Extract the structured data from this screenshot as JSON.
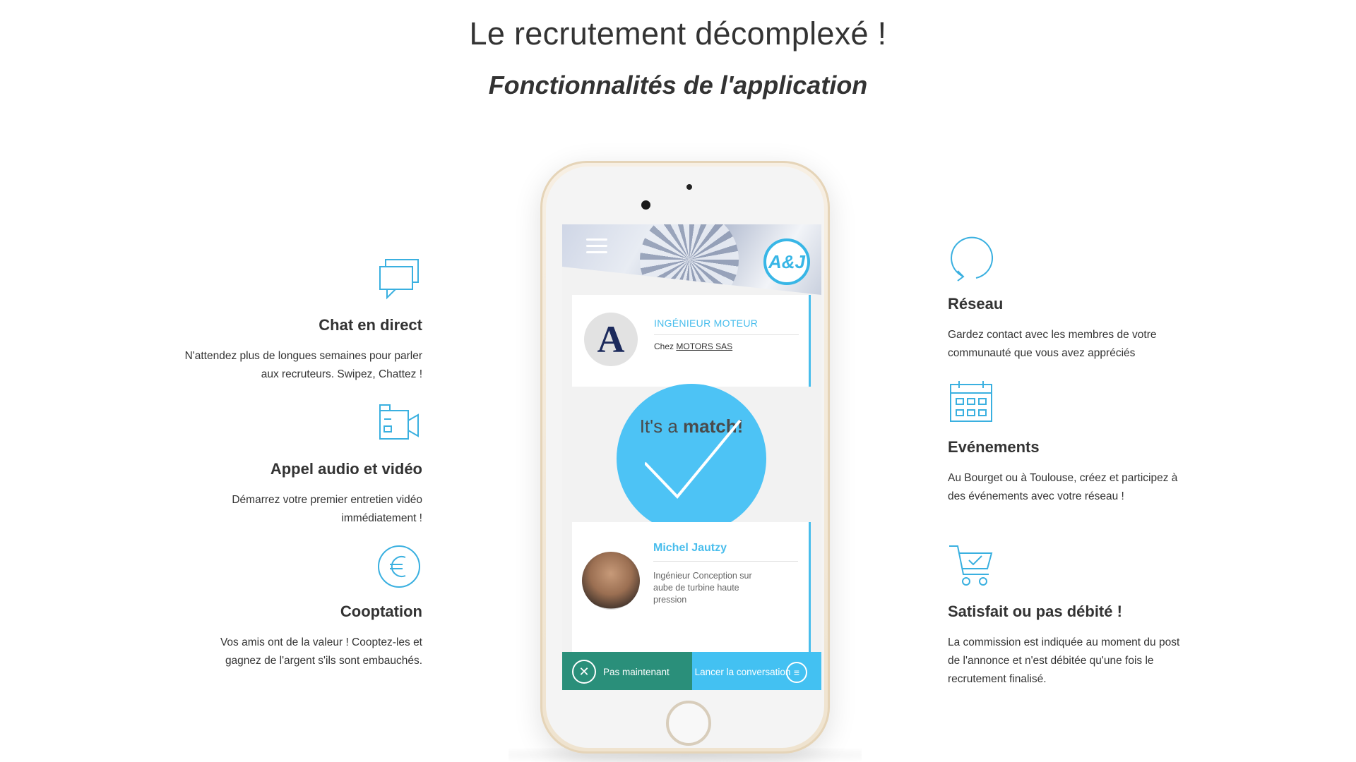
{
  "header": {
    "title": "Le recrutement décomplexé !",
    "subtitle": "Fonctionnalités de l'application"
  },
  "features_left": [
    {
      "icon": "chat-icon",
      "title": "Chat en direct",
      "text": "N'attendez plus de longues semaines pour parler aux recruteurs. Swipez, Chattez !"
    },
    {
      "icon": "video-call-icon",
      "title": "Appel audio et vidéo",
      "text": "Démarrez votre premier entretien vidéo immédiatement !"
    },
    {
      "icon": "euro-icon",
      "title": "Cooptation",
      "text": "Vos amis ont de la valeur ! Cooptez-les et gagnez de l'argent s'ils sont embauchés."
    }
  ],
  "features_right": [
    {
      "icon": "refresh-icon",
      "title": "Réseau",
      "text": "Gardez contact avec les membres de votre communauté que vous avez appréciés"
    },
    {
      "icon": "calendar-icon",
      "title": "Evénements",
      "text": "Au Bourget ou à Toulouse, créez et participez à des événements avec votre réseau !"
    },
    {
      "icon": "cart-icon",
      "title": "Satisfait ou pas débité !",
      "text": "La commission est indiquée au moment du post de l'annonce et n'est débitée qu'une fois le recrutement finalisé."
    }
  ],
  "phone": {
    "brand_logo": "A&J",
    "job": {
      "company_logo_letter": "A",
      "title": "INGÉNIEUR MOTEUR",
      "prefix": "Chez",
      "company": "MOTORS SAS"
    },
    "match": {
      "prefix": "It's a",
      "emphasis": "match!"
    },
    "profile": {
      "name": "Michel Jautzy",
      "role": "Ingénieur Conception sur aube de turbine haute pression"
    },
    "actions": {
      "decline_label": "Pas maintenant",
      "chat_label": "Lancer la conversation"
    }
  },
  "colors": {
    "accent": "#48bdec",
    "icon_blue": "#3ab0e0",
    "decline": "#2a8f7a",
    "chat": "#43c1f2"
  }
}
